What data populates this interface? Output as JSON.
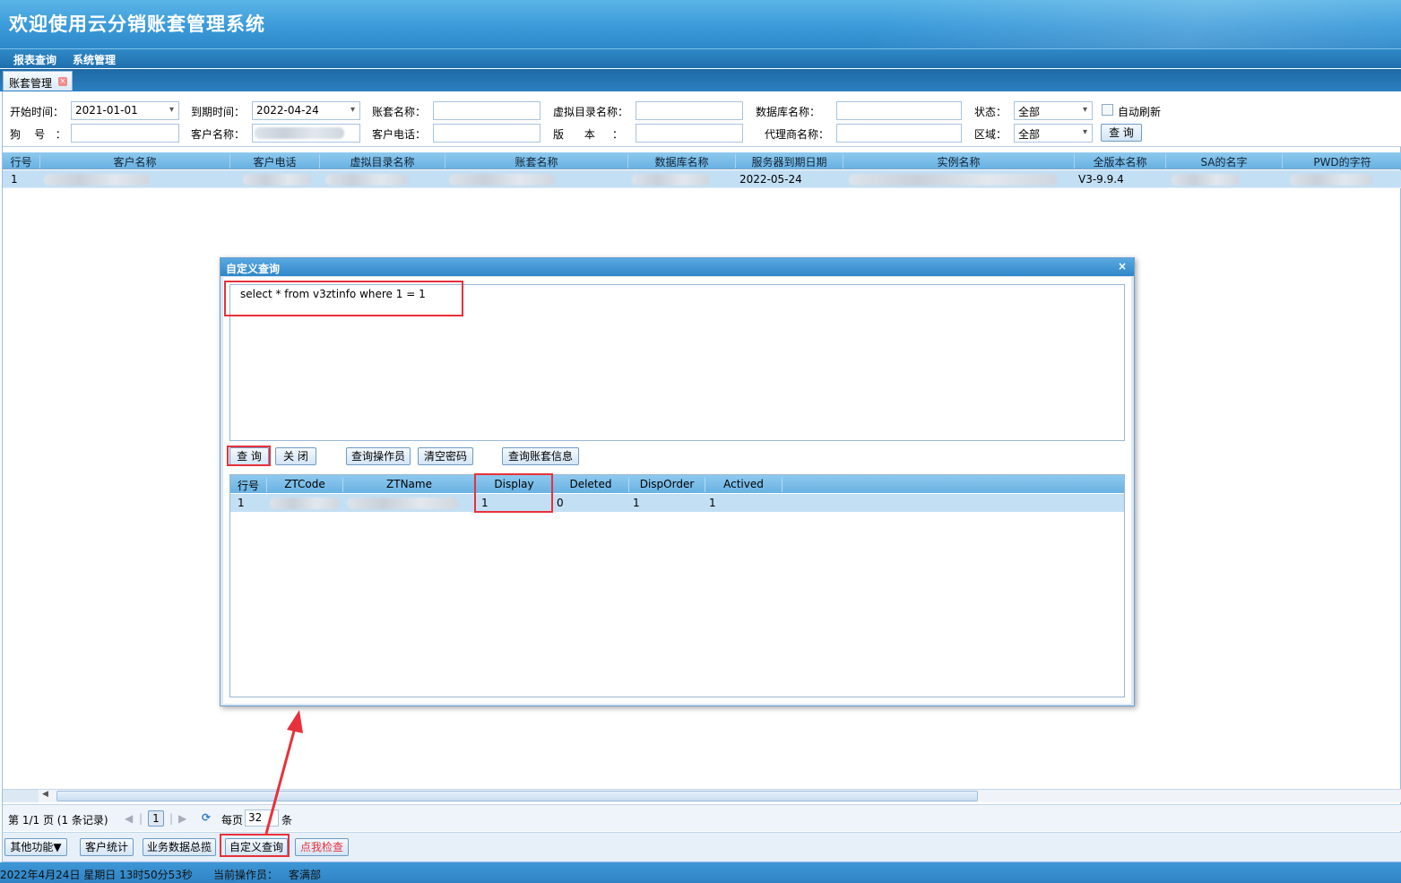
{
  "app": {
    "title": "欢迎使用云分销账套管理系统"
  },
  "menu": [
    {
      "label": "报表查询"
    },
    {
      "label": "系统管理"
    }
  ],
  "tab": {
    "label": "账套管理"
  },
  "filters": {
    "start_time_label": "开始时间：",
    "start_time_value": "2021-01-01",
    "expire_time_label": "到期时间：",
    "expire_time_value": "2022-04-24",
    "account_name_label": "账套名称：",
    "virtual_dir_label": "虚拟目录名称：",
    "db_name_label": "数据库名称：",
    "status_label": "状态：",
    "status_value": "全部",
    "auto_refresh_label": "自动刷新",
    "dog_no_label": "狗    号   ：",
    "customer_name_label": "客户名称：",
    "customer_phone_label": "客户电话：",
    "version_label": "版      本     ：",
    "agent_name_label": "代理商名称：",
    "region_label": "区域：",
    "region_value": "全部",
    "query_button": "查 询"
  },
  "grid": {
    "columns": [
      "行号",
      "客户名称",
      "客户电话",
      "虚拟目录名称",
      "账套名称",
      "数据库名称",
      "服务器到期日期",
      "实例名称",
      "全版本名称",
      "SA的名字",
      "PWD的字符"
    ],
    "rows": [
      {
        "row_no": "1",
        "server_expire": "2022-05-24",
        "full_version": "V3-9.9.4"
      }
    ]
  },
  "pager": {
    "page_info": "第 1/1 页 (1 条记录)",
    "current_page": "1",
    "per_page_label": "每页",
    "per_page_value": "32",
    "unit": "条"
  },
  "bottom_buttons": {
    "other": "其他功能▼",
    "customer_stats": "客户统计",
    "business_overview": "业务数据总揽",
    "custom_query": "自定义查询",
    "check": "点我检查"
  },
  "status": {
    "datetime": "2022年4月24日 星期日 13时50分53秒",
    "operator_label": "当前操作员：",
    "operator": "客满部"
  },
  "dialog": {
    "title": "自定义查询",
    "close": "×",
    "sql": "select * from v3ztinfo where 1 = 1",
    "buttons": {
      "query": "查 询",
      "close": "关 闭",
      "query_operator": "查询操作员",
      "clear_password": "清空密码",
      "query_account": "查询账套信息"
    },
    "columns": [
      "行号",
      "ZTCode",
      "ZTName",
      "Display",
      "Deleted",
      "DispOrder",
      "Actived"
    ],
    "rows": [
      {
        "row_no": "1",
        "display": "1",
        "deleted": "0",
        "disporder": "1",
        "actived": "1"
      }
    ]
  },
  "colors": {
    "accent": "#3b9ad9",
    "highlight": "#e8313a",
    "row_selected": "#c3dff4"
  }
}
